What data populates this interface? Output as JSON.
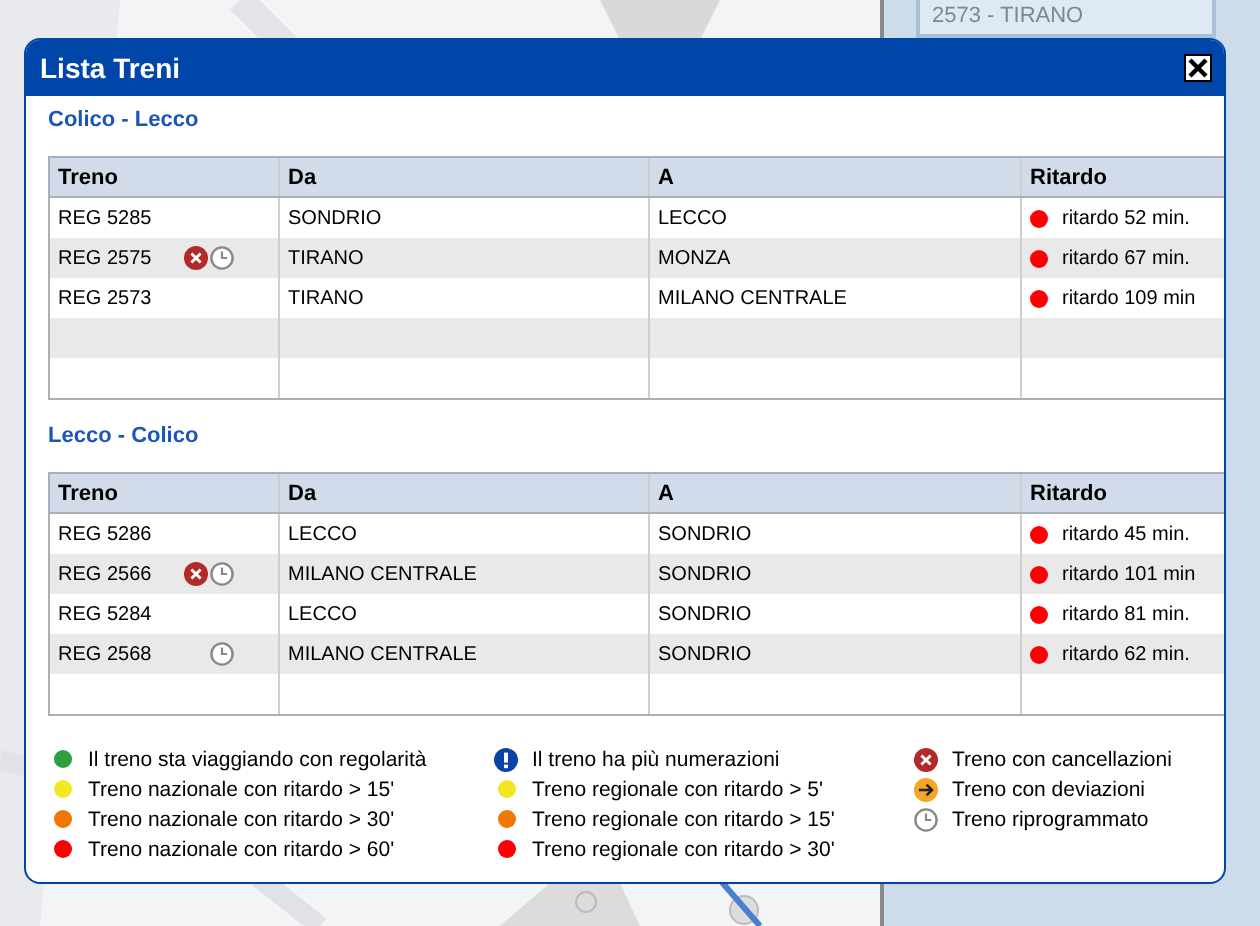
{
  "side_panel": {
    "field": "2573 - TIRANO"
  },
  "dialog": {
    "title": "Lista Treni",
    "sections": [
      {
        "title": "Colico - Lecco",
        "columns": [
          "Treno",
          "Da",
          "A",
          "Ritardo"
        ],
        "rows": [
          {
            "train": "REG 5285",
            "cancelled": false,
            "rescheduled": false,
            "from": "SONDRIO",
            "to": "LECCO",
            "delay": "ritardo 52 min.",
            "color": "#ff0000"
          },
          {
            "train": "REG 2575",
            "cancelled": true,
            "rescheduled": true,
            "from": "TIRANO",
            "to": "MONZA",
            "delay": "ritardo 67 min.",
            "color": "#ff0000"
          },
          {
            "train": "REG 2573",
            "cancelled": false,
            "rescheduled": false,
            "from": "TIRANO",
            "to": "MILANO CENTRALE",
            "delay": "ritardo 109 min",
            "color": "#ff0000"
          }
        ]
      },
      {
        "title": "Lecco - Colico",
        "columns": [
          "Treno",
          "Da",
          "A",
          "Ritardo"
        ],
        "rows": [
          {
            "train": "REG 5286",
            "cancelled": false,
            "rescheduled": false,
            "from": "LECCO",
            "to": "SONDRIO",
            "delay": "ritardo 45 min.",
            "color": "#ff0000"
          },
          {
            "train": "REG 2566",
            "cancelled": true,
            "rescheduled": true,
            "from": "MILANO CENTRALE",
            "to": "SONDRIO",
            "delay": "ritardo 101 min",
            "color": "#ff0000"
          },
          {
            "train": "REG 5284",
            "cancelled": false,
            "rescheduled": false,
            "from": "LECCO",
            "to": "SONDRIO",
            "delay": "ritardo 81 min.",
            "color": "#ff0000"
          },
          {
            "train": "REG 2568",
            "cancelled": false,
            "rescheduled": true,
            "from": "MILANO CENTRALE",
            "to": "SONDRIO",
            "delay": "ritardo 62 min.",
            "color": "#ff0000"
          }
        ]
      }
    ],
    "legend": [
      [
        {
          "kind": "dot",
          "color": "#2e9e3e",
          "label": "Il treno sta viaggiando con regolarità"
        },
        {
          "kind": "dot",
          "color": "#f5e624",
          "label": "Treno nazionale con ritardo > 15'"
        },
        {
          "kind": "dot",
          "color": "#f07800",
          "label": "Treno nazionale con ritardo > 30'"
        },
        {
          "kind": "dot",
          "color": "#ff0000",
          "label": "Treno nazionale con ritardo > 60'"
        }
      ],
      [
        {
          "kind": "info",
          "label": "Il treno ha più numerazioni"
        },
        {
          "kind": "dot",
          "color": "#f5e624",
          "label": "Treno regionale con ritardo > 5'"
        },
        {
          "kind": "dot",
          "color": "#f07800",
          "label": "Treno regionale con ritardo > 15'"
        },
        {
          "kind": "dot",
          "color": "#ff0000",
          "label": "Treno regionale con ritardo > 30'"
        }
      ],
      [
        {
          "kind": "cancel",
          "label": "Treno con cancellazioni"
        },
        {
          "kind": "deviation",
          "label": "Treno con deviazioni"
        },
        {
          "kind": "clock",
          "label": "Treno riprogrammato"
        }
      ]
    ]
  }
}
